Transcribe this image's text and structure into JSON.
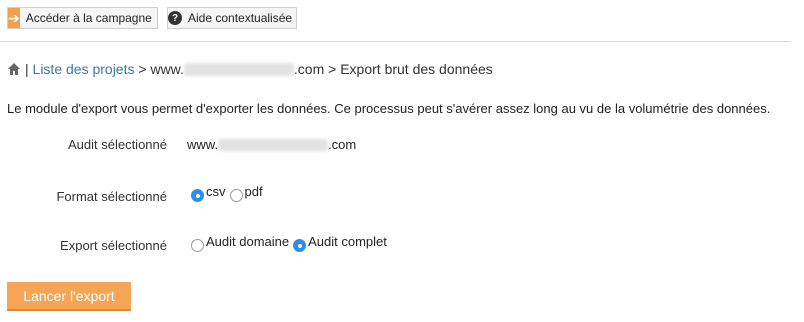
{
  "toolbar": {
    "campaign_label": "Accéder à la campagne",
    "help_label": "Aide contextualisée"
  },
  "breadcrumb": {
    "separator": "|",
    "projects_link": "Liste des projets",
    "arrow1": ">",
    "domain_prefix": "www.",
    "domain_suffix": ".com",
    "arrow2": ">",
    "current": "Export brut des données"
  },
  "intro_text": "Le module d'export vous permet d'exporter les données. Ce processus peut s'avérer assez long au vu de la volumétrie des données.",
  "form": {
    "audit_label": "Audit sélectionné",
    "audit_prefix": "www.",
    "audit_suffix": ".com",
    "format_label": "Format sélectionné",
    "format_options": [
      {
        "label": "csv",
        "selected": true
      },
      {
        "label": "pdf",
        "selected": false
      }
    ],
    "export_label": "Export sélectionné",
    "export_options": [
      {
        "label": "Audit domaine",
        "selected": false
      },
      {
        "label": "Audit complet",
        "selected": true
      }
    ]
  },
  "launch_label": "Lancer l'export",
  "colors": {
    "accent_orange": "#f5a553",
    "link_blue": "#3a7d96",
    "radio_blue": "#2d8ef0"
  },
  "icons": {
    "campaign": "arrow-right-icon",
    "help": "question-mark-icon",
    "home": "home-icon"
  }
}
